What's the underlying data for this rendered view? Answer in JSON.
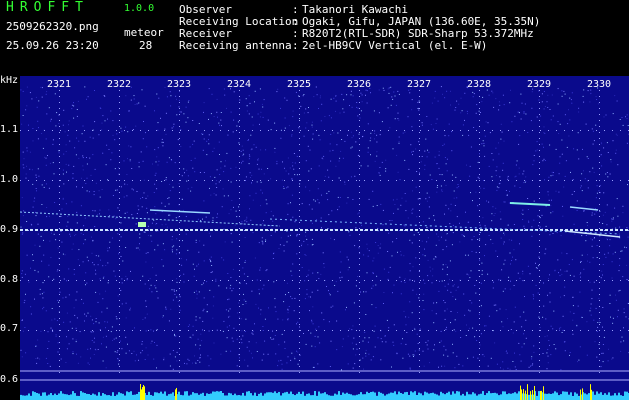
{
  "header": {
    "app_title": "HROFFT",
    "app_version": "1.0.0",
    "file_name": "2509262320.png",
    "meteor_label": "meteor",
    "date_time": "25.09.26 23:20",
    "meteor_count": "28",
    "info": [
      {
        "label": "Observer",
        "value": "Takanori Kawachi"
      },
      {
        "label": "Receiving Location",
        "value": "Ogaki, Gifu, JAPAN (136.60E, 35.35N)"
      },
      {
        "label": "Receiver",
        "value": "R820T2(RTL-SDR) SDR-Sharp 53.372MHz"
      },
      {
        "label": "Receiving antenna",
        "value": "2el-HB9CV Vertical (el. E-W)"
      }
    ]
  },
  "axes": {
    "y_unit": "kHz",
    "x_ticks": [
      "2321",
      "2322",
      "2323",
      "2324",
      "2325",
      "2326",
      "2327",
      "2328",
      "2329",
      "2330"
    ],
    "y_ticks": [
      "1.1",
      "1.0",
      "0.9",
      "0.8",
      "0.7",
      "0.6"
    ]
  },
  "colors": {
    "background": "#000000",
    "spectrum_bg": "#0a0a8c",
    "text_green": "#33ff33",
    "text_white": "#ffffff",
    "carrier": "#cfe8ff",
    "level_bar": "#33ccff",
    "level_peak": "#ffff00"
  }
}
